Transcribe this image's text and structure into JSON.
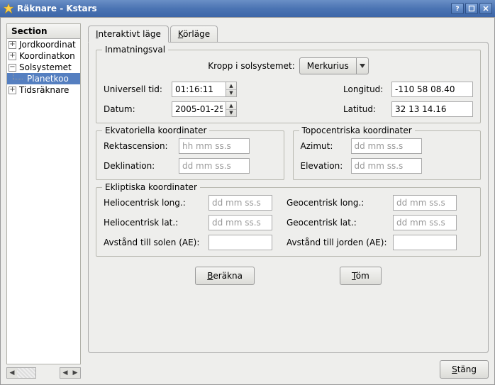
{
  "window": {
    "title": "Räknare - Kstars"
  },
  "sidebar": {
    "header": "Section",
    "items": [
      {
        "label": "Jordkoordinat",
        "expanded": false
      },
      {
        "label": "Koordinatkon",
        "expanded": false
      },
      {
        "label": "Solsystemet",
        "expanded": true,
        "children": [
          {
            "label": "Planetkoo",
            "selected": true
          }
        ]
      },
      {
        "label": "Tidsräknare",
        "expanded": false
      }
    ]
  },
  "tabs": {
    "interactive": {
      "label_pre": "",
      "u": "I",
      "label_post": "nteraktivt läge"
    },
    "batch": {
      "label_pre": "",
      "u": "K",
      "label_post": "örläge"
    }
  },
  "input_group": {
    "legend": "Inmatningsval",
    "body_label": "Kropp i solsystemet:",
    "body_value": "Merkurius",
    "ut_label": "Universell tid:",
    "ut_value": "01:16:11",
    "date_label": "Datum:",
    "date_value": "2005-01-25",
    "lon_label": "Longitud:",
    "lon_value": "-110 58 08.40",
    "lat_label": "Latitud:",
    "lat_value": "32 13 14.16"
  },
  "eq_group": {
    "legend": "Ekvatoriella koordinater",
    "ra_label": "Rektascension:",
    "ra_placeholder": "hh mm ss.s",
    "dec_label": "Deklination:",
    "dec_placeholder": "dd mm ss.s"
  },
  "topo_group": {
    "legend": "Topocentriska koordinater",
    "az_label": "Azimut:",
    "az_placeholder": "dd mm ss.s",
    "el_label": "Elevation:",
    "el_placeholder": "dd mm ss.s"
  },
  "ecl_group": {
    "legend": "Ekliptiska koordinater",
    "helio_lon_label": "Heliocentrisk long.:",
    "helio_lat_label": "Heliocentrisk lat.:",
    "geo_lon_label": "Geocentrisk long.:",
    "geo_lat_label": "Geocentrisk lat.:",
    "placeholder": "dd mm ss.s",
    "dist_sun_label": "Avstånd till solen (AE):",
    "dist_earth_label": "Avstånd till jorden (AE):"
  },
  "buttons": {
    "calc_pre": "",
    "calc_u": "B",
    "calc_post": "eräkna",
    "clear_pre": "",
    "clear_u": "T",
    "clear_post": "öm",
    "close_pre": "",
    "close_u": "S",
    "close_post": "täng"
  }
}
